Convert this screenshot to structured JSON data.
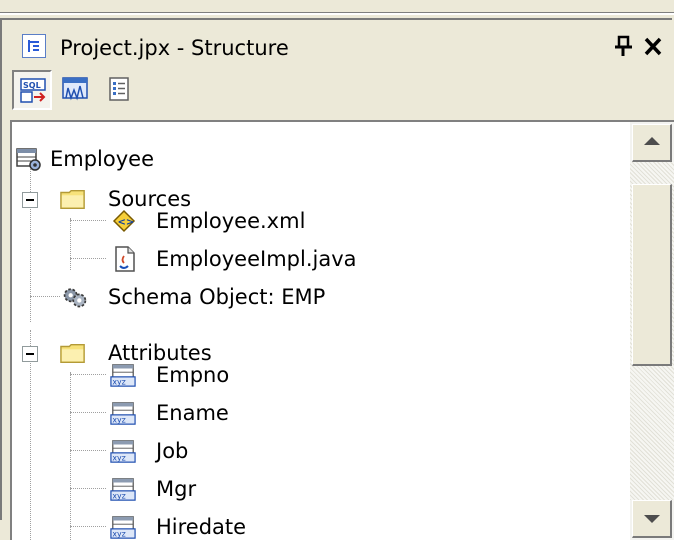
{
  "window": {
    "title": "Project.jpx - Structure"
  },
  "toolbar": {
    "buttons": [
      {
        "icon": "sql-view-icon",
        "active": true
      },
      {
        "icon": "diagram-view-icon",
        "active": false
      },
      {
        "icon": "list-view-icon",
        "active": false
      }
    ]
  },
  "tree": {
    "root": {
      "label": "Employee",
      "icon": "entity-object-icon"
    },
    "sources_folder": {
      "label": "Sources",
      "icon": "folder-icon",
      "expanded": true
    },
    "source_files": [
      {
        "label": "Employee.xml",
        "icon": "xml-file-icon"
      },
      {
        "label": "EmployeeImpl.java",
        "icon": "java-file-icon"
      }
    ],
    "schema_object": {
      "label": "Schema Object: EMP",
      "icon": "gears-icon"
    },
    "attributes_folder": {
      "label": "Attributes",
      "icon": "folder-icon",
      "expanded": true
    },
    "attributes": [
      {
        "label": "Empno",
        "icon": "attribute-icon"
      },
      {
        "label": "Ename",
        "icon": "attribute-icon"
      },
      {
        "label": "Job",
        "icon": "attribute-icon"
      },
      {
        "label": "Mgr",
        "icon": "attribute-icon"
      },
      {
        "label": "Hiredate",
        "icon": "attribute-icon"
      }
    ]
  },
  "colors": {
    "chrome": "#ece9d8",
    "folder": "#f7e27a",
    "accent_blue": "#3a6fc4"
  }
}
